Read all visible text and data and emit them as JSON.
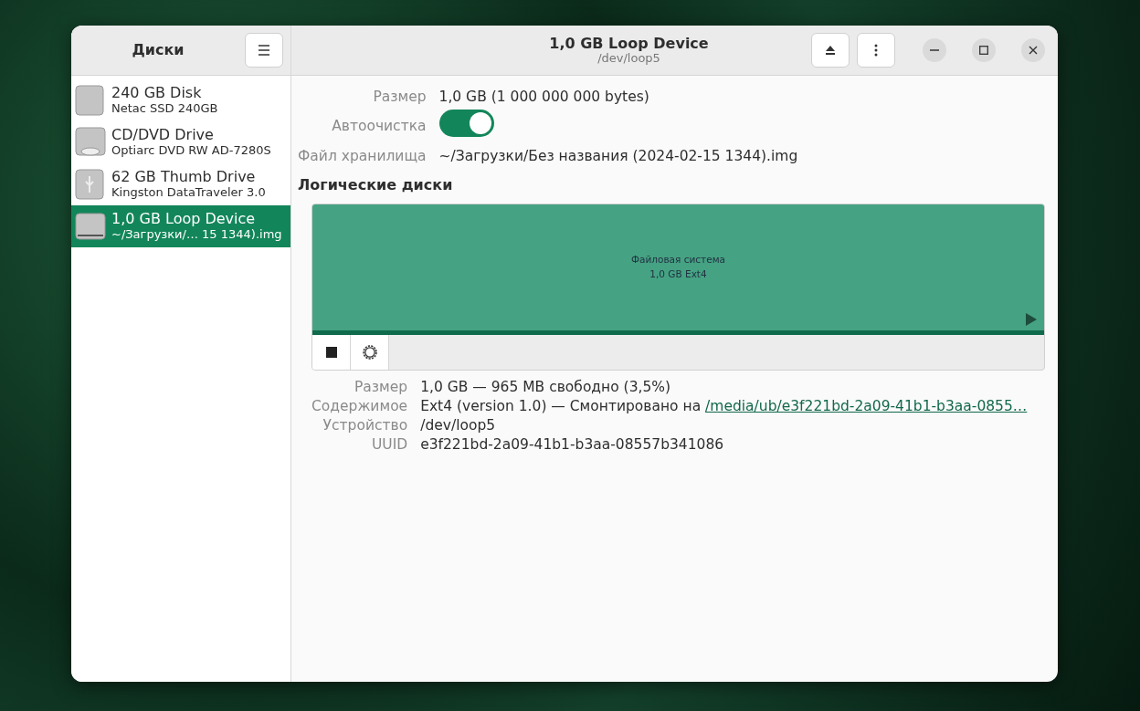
{
  "sidebar": {
    "title": "Диски",
    "items": [
      {
        "kind": "ssd",
        "name": "240 GB Disk",
        "detail": "Netac SSD 240GB",
        "selected": false
      },
      {
        "kind": "optical",
        "name": "CD/DVD Drive",
        "detail": "Optiarc DVD RW AD-7280S",
        "selected": false
      },
      {
        "kind": "usb",
        "name": "62 GB Thumb Drive",
        "detail": "Kingston DataTraveler 3.0",
        "selected": false
      },
      {
        "kind": "loop",
        "name": "1,0 GB Loop Device",
        "detail": "~/Загрузки/…  15 1344).img",
        "selected": true
      }
    ]
  },
  "header": {
    "title": "1,0 GB Loop Device",
    "subtitle": "/dev/loop5"
  },
  "device_info": [
    {
      "kind": "text",
      "label": "Размер",
      "value": "1,0 GB (1 000 000 000 bytes)"
    },
    {
      "kind": "switch",
      "label": "Автоочистка",
      "on": true
    },
    {
      "kind": "text",
      "label": "Файл хранилища",
      "value": "~/Загрузки/Без названия (2024-02-15 1344).img"
    }
  ],
  "volumes": {
    "heading": "Логические диски",
    "partitions": [
      {
        "lines": [
          "Файловая система",
          "1,0 GB Ext4"
        ],
        "selected": true
      }
    ]
  },
  "volume_info": [
    {
      "label": "Размер",
      "value": "1,0 GB — 965 MB свободно (3,5%)"
    },
    {
      "label": "Содержимое",
      "value": "Ext4 (version 1.0) — Смонтировано на ",
      "link": "/media/ub/e3f221bd-2a09-41b1-b3aa-0855…"
    },
    {
      "label": "Устройство",
      "value": "/dev/loop5"
    },
    {
      "label": "UUID",
      "value": "e3f221bd-2a09-41b1-b3aa-08557b341086"
    }
  ]
}
